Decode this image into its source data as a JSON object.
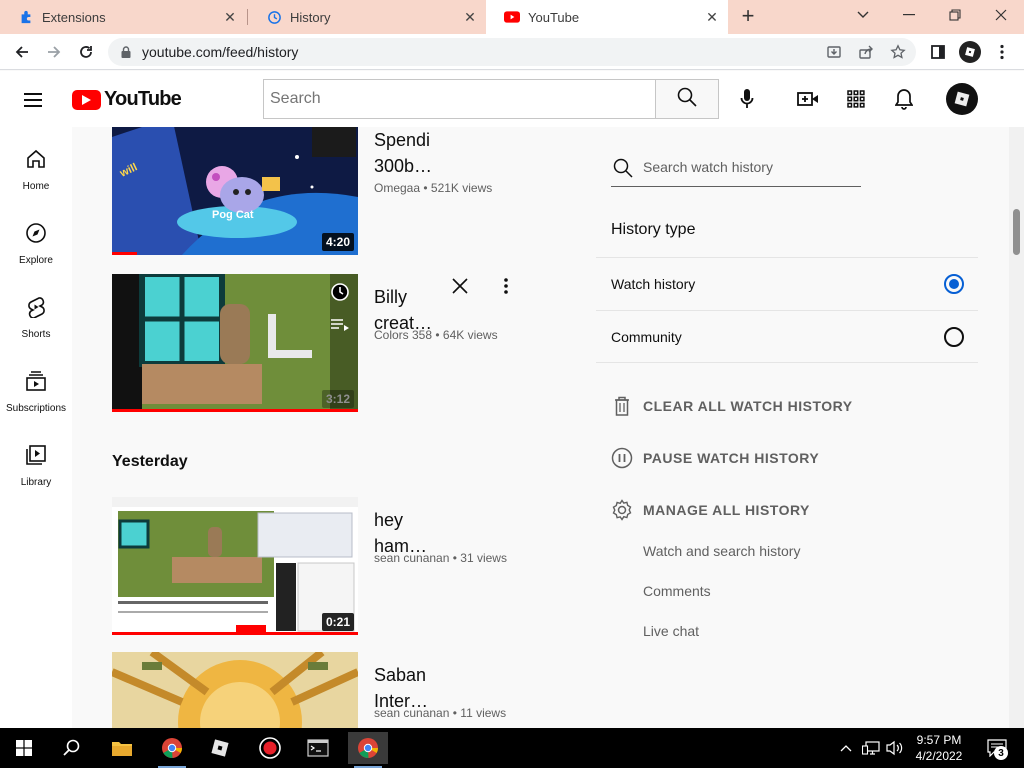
{
  "browser": {
    "tabs": [
      {
        "label": "Extensions",
        "active": false
      },
      {
        "label": "History",
        "active": false
      },
      {
        "label": "YouTube",
        "active": true
      }
    ],
    "url": "youtube.com/feed/history"
  },
  "header": {
    "logo_text": "YouTube",
    "search_placeholder": "Search"
  },
  "guide": [
    {
      "label": "Home",
      "icon": "home-icon"
    },
    {
      "label": "Explore",
      "icon": "compass-icon"
    },
    {
      "label": "Shorts",
      "icon": "shorts-icon"
    },
    {
      "label": "Subscriptions",
      "icon": "subscriptions-icon"
    },
    {
      "label": "Library",
      "icon": "library-icon"
    }
  ],
  "feed": {
    "videos_top": [
      {
        "title": "Spendi 300b…",
        "channel": "Omegaa",
        "views": "521K views",
        "duration": "4:20"
      },
      {
        "title": "Billy creat…",
        "channel": "Colors 358",
        "views": "64K views",
        "duration": "3:12"
      }
    ],
    "section_yesterday": "Yesterday",
    "videos_yesterday": [
      {
        "title": "hey ham…",
        "channel": "sean cunanan",
        "views": "31 views",
        "duration": "0:21"
      },
      {
        "title": "Saban Inter…",
        "channel": "sean cunanan",
        "views": "11 views"
      }
    ],
    "thumb_text": {
      "pog_cat": "Pog Cat"
    }
  },
  "sidebar": {
    "search_placeholder": "Search watch history",
    "history_type_label": "History type",
    "options": [
      {
        "label": "Watch history",
        "selected": true
      },
      {
        "label": "Community",
        "selected": false
      }
    ],
    "actions": [
      {
        "label": "CLEAR ALL WATCH HISTORY",
        "icon": "trash-icon"
      },
      {
        "label": "PAUSE WATCH HISTORY",
        "icon": "pause-icon"
      },
      {
        "label": "MANAGE ALL HISTORY",
        "icon": "gear-icon"
      }
    ],
    "links": [
      "Watch and search history",
      "Comments",
      "Live chat"
    ]
  },
  "taskbar": {
    "time": "9:57 PM",
    "date": "4/2/2022",
    "notification_count": "3"
  },
  "colors": {
    "brand_red": "#ff0000",
    "accent_blue": "#065fd4"
  }
}
